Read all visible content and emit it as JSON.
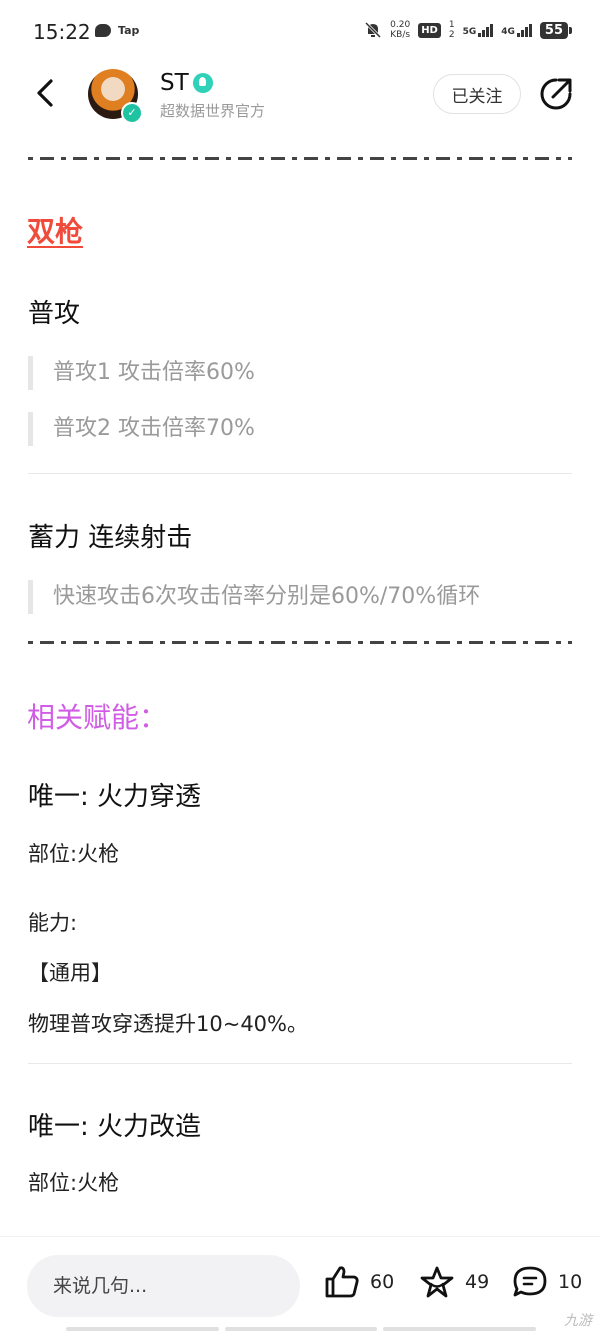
{
  "status_bar": {
    "time": "15:22",
    "tap_label": "Tap",
    "net_speed": "0.20",
    "net_unit": "KB/s",
    "hd": "HD",
    "sim1": "1",
    "sim2": "2",
    "signal1_label": "5G",
    "signal2_label": "4G",
    "battery": "55"
  },
  "header": {
    "username": "ST",
    "subtitle": "超数据世界官方",
    "follow_label": "已关注"
  },
  "article": {
    "section_title": "双枪",
    "normal_attack": {
      "title": "普攻",
      "lines": [
        "普攻1 攻击倍率60%",
        "普攻2 攻击倍率70%"
      ]
    },
    "charge": {
      "title": "蓄力 连续射击",
      "lines": [
        "快速攻击6次攻击倍率分别是60%/70%循环"
      ]
    },
    "talents_title": "相关赋能：",
    "talent1": {
      "title": "唯一: 火力穿透",
      "slot": "部位:火枪",
      "ability_label": "能力:",
      "tag": "【通用】",
      "effect": "物理普攻穿透提升10~40%。"
    },
    "talent2": {
      "title": "唯一: 火力改造",
      "slot": "部位:火枪"
    }
  },
  "bottom_bar": {
    "comment_placeholder": "来说几句...",
    "likes": "60",
    "favorites": "49",
    "comments": "10",
    "watermark": "九游"
  },
  "colors": {
    "section_red": "#f04a3b",
    "talent_purple": "#d15ce6",
    "verified_teal": "#1fc3a2"
  }
}
